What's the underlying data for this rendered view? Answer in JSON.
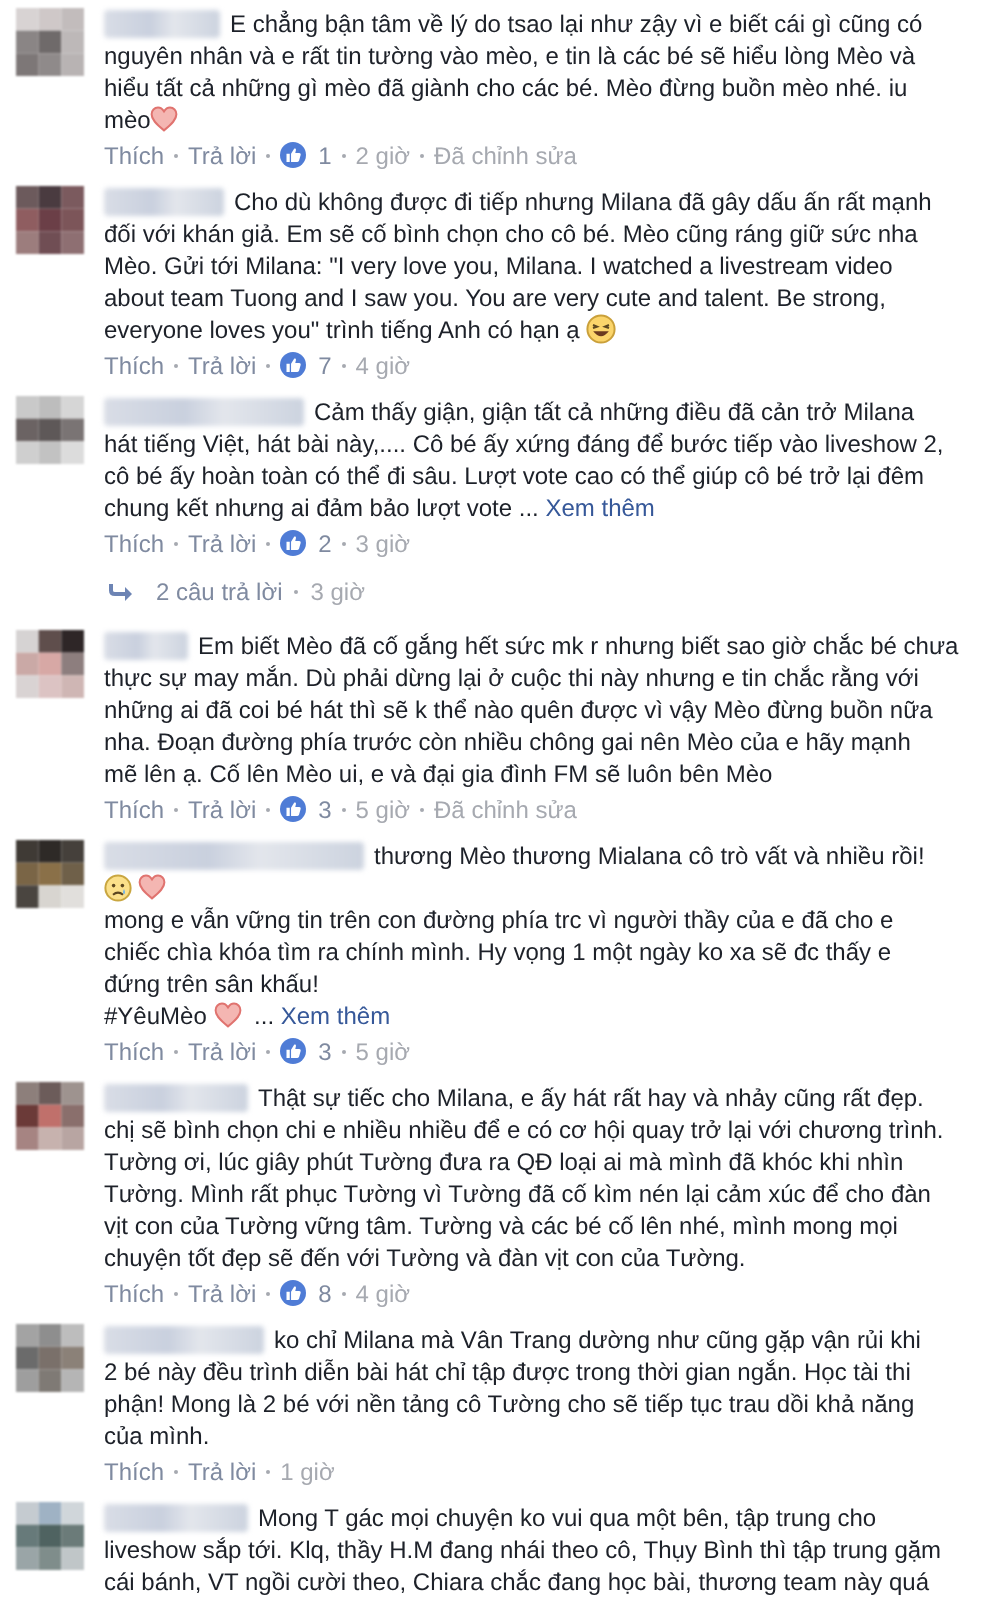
{
  "comments": [
    {
      "lead": "E chẳng bận tâm về lý do tsao lại như zậy vì e biết cái gì cũng có",
      "parts": [
        {
          "kind": "text",
          "text": "nguyên nhân và e rất tin tường vào mèo, e tin là các bé sẽ hiểu lòng Mèo và hiểu tất cả những gì mèo đã giành cho các bé. Mèo đừng buồn mèo nhé. iu mèo"
        },
        {
          "kind": "heart"
        }
      ],
      "like": "Thích",
      "reply": "Trả lời",
      "likes": "1",
      "time": "2 giờ",
      "edited": "Đã chỉnh sửa"
    },
    {
      "lead": "Cho dù không được đi tiếp nhưng Milana đã gây dấu ấn rất mạnh",
      "parts": [
        {
          "kind": "text",
          "text": "đối với khán giả. Em sẽ cố bình chọn cho cô bé. Mèo cũng ráng giữ sức nha Mèo. Gửi tới Milana: \"I very love you, Milana. I watched a livestream video about team Tuong and I saw you. You are very cute and talent. Be strong, everyone loves you\" trình tiếng Anh có hạn ạ "
        },
        {
          "kind": "laughing"
        }
      ],
      "like": "Thích",
      "reply": "Trả lời",
      "likes": "7",
      "time": "4 giờ"
    },
    {
      "lead": "Cảm thấy giận, giận tất cả những điều đã cản trở Milana",
      "parts": [
        {
          "kind": "text",
          "text": "hát tiếng Việt, hát bài này,.... Cô bé ấy xứng đáng để bước tiếp vào liveshow 2, cô bé ấy hoàn toàn có thể đi sâu. Lượt vote cao có thể giúp cô bé trở lại đêm chung kết nhưng ai đảm bảo lượt vote ... "
        },
        {
          "kind": "more",
          "text": "Xem thêm"
        }
      ],
      "like": "Thích",
      "reply": "Trả lời",
      "likes": "2",
      "time": "3 giờ",
      "replies": {
        "label": "2 câu trả lời",
        "time": "3 giờ"
      }
    },
    {
      "lead": "Em biết Mèo đã cố gắng hết sức mk r nhưng biết sao giờ chắc bé chưa",
      "parts": [
        {
          "kind": "text",
          "text": "thực sự may mắn. Dù phải dừng lại ở cuộc thi này nhưng e tin chắc rằng với những ai đã coi bé hát thì sẽ k thể nào quên được vì vậy Mèo đừng buồn nữa nha. Đoạn đường phía trước còn nhiều chông gai nên Mèo của e hãy mạnh mẽ lên ạ. Cố lên Mèo ui, e và đại gia đình FM sẽ luôn bên Mèo"
        }
      ],
      "like": "Thích",
      "reply": "Trả lời",
      "likes": "3",
      "time": "5 giờ",
      "edited": "Đã chỉnh sửa"
    },
    {
      "lead": "thương Mèo thương Mialana cô trò vất và nhiều rồi!",
      "parts": [
        {
          "kind": "sad"
        },
        {
          "kind": "heart"
        },
        {
          "kind": "text",
          "text": "\nmong e vẫn vững tin trên con đường phía trc vì người thầy của e đã cho e chiếc chìa khóa tìm ra chính mình. Hy vọng 1 một ngày ko xa sẽ đc thấy e đứng trên sân khấu!\n#YêuMèo "
        },
        {
          "kind": "heart"
        },
        {
          "kind": "text",
          "text": " ... "
        },
        {
          "kind": "more",
          "text": "Xem thêm"
        }
      ],
      "like": "Thích",
      "reply": "Trả lời",
      "likes": "3",
      "time": "5 giờ"
    },
    {
      "lead": "Thật sự tiếc cho Milana, e ấy hát rất hay và nhảy cũng rất đẹp.",
      "parts": [
        {
          "kind": "text",
          "text": "chị sẽ bình chọn chi e nhiều nhiều để e có cơ hội quay trở lại với chương trình. Tường ơi, lúc giây phút Tường đưa ra QĐ loại ai mà mình đã khóc khi nhìn Tường. Mình rất phục Tường vì Tường đã cố kìm nén lại cảm xúc để cho đàn vịt con của Tường vững tâm. Tường và các bé cố lên nhé, mình mong mọi chuyện tốt đẹp sẽ đến với Tường và đàn vịt con của Tường."
        }
      ],
      "like": "Thích",
      "reply": "Trả lời",
      "likes": "8",
      "time": "4 giờ"
    },
    {
      "lead": "ko chỉ Milana mà Vân Trang dường như cũng gặp vận rủi khi",
      "parts": [
        {
          "kind": "text",
          "text": "2 bé này đều trình diễn bài hát chỉ tập được trong thời gian ngắn. Học tài thi phận! Mong là 2 bé với nền tảng cô Tường cho sẽ tiếp tục trau dồi khả năng của mình."
        }
      ],
      "like": "Thích",
      "reply": "Trả lời",
      "time": "1 giờ"
    },
    {
      "lead": "Mong T gác mọi chuyện ko vui qua một bên, tập trung cho",
      "parts": [
        {
          "kind": "text",
          "text": "liveshow sắp tới. Klq, thầy H.M đang nhái theo cô, Thụy Bình thì tập trung gặm cái bánh, VT ngồi cười theo, Chiara chắc đang học bài, thương team này quá"
        }
      ]
    }
  ]
}
